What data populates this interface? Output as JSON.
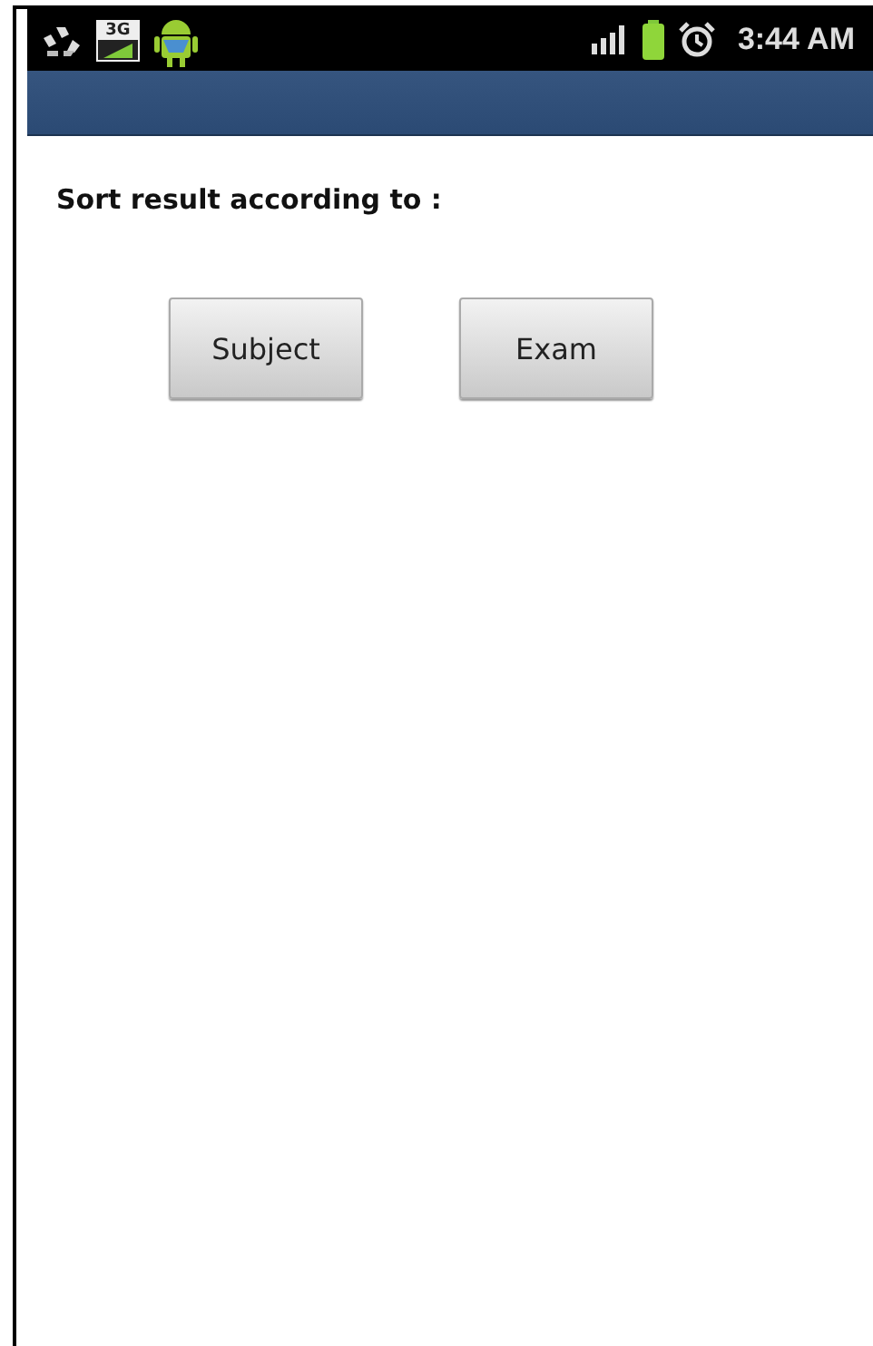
{
  "status_bar": {
    "time": "3:44 AM",
    "network_label": "3G"
  },
  "prompt": "Sort result according to :",
  "buttons": [
    "Subject",
    "Exam"
  ]
}
